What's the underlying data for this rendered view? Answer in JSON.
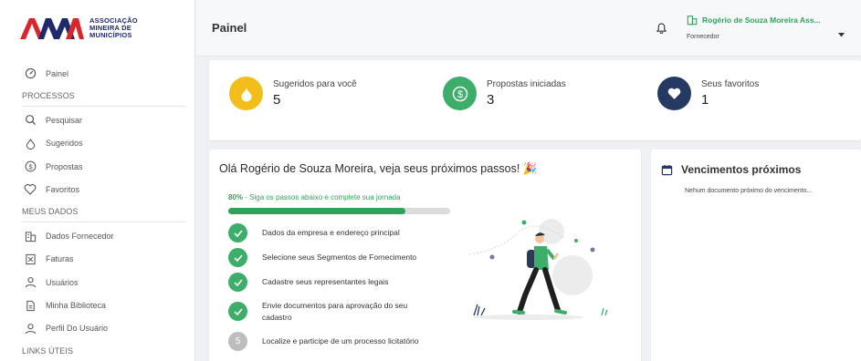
{
  "brand": {
    "name_line1": "ASSOCIAÇÃO",
    "name_line2": "MINEIRA DE",
    "name_line3": "MUNICÍPIOS",
    "colors": {
      "red": "#d9262c",
      "navy": "#1f2a6b"
    }
  },
  "sidebar": {
    "top_item": {
      "label": "Painel",
      "icon": "gauge-icon"
    },
    "sections": [
      {
        "title": "PROCESSOS",
        "items": [
          {
            "label": "Pesquisar",
            "icon": "search-icon"
          },
          {
            "label": "Sugeridos",
            "icon": "drop-icon"
          },
          {
            "label": "Propostas",
            "icon": "dollar-icon"
          },
          {
            "label": "Favoritos",
            "icon": "heart-icon"
          }
        ]
      },
      {
        "title": "MEUS DADOS",
        "items": [
          {
            "label": "Dados Fornecedor",
            "icon": "building-icon"
          },
          {
            "label": "Faturas",
            "icon": "invoice-icon"
          },
          {
            "label": "Usuários",
            "icon": "user-icon"
          },
          {
            "label": "Minha Biblioteca",
            "icon": "document-icon"
          },
          {
            "label": "Perfil Do Usuário",
            "icon": "user-profile-icon"
          }
        ]
      },
      {
        "title": "LINKS ÚTEIS",
        "items": []
      }
    ]
  },
  "header": {
    "title": "Painel",
    "user_name": "Rogério de Souza Moreira Ass...",
    "user_role": "Fornecedor",
    "accent": "#2fa35b"
  },
  "stats": [
    {
      "label": "Sugeridos para você",
      "value": "5",
      "icon": "drop-icon",
      "color": "#f2be1b"
    },
    {
      "label": "Propostas iniciadas",
      "value": "3",
      "icon": "dollar-icon",
      "color": "#3dad6a"
    },
    {
      "label": "Seus favoritos",
      "value": "1",
      "icon": "heart-icon",
      "color": "#253a63"
    }
  ],
  "main": {
    "title": "Olá Rogério de Souza Moreira, veja seus próximos passos! 🎉",
    "progress_percent": "80%",
    "progress_text": " - Siga os passos abaixo e complete sua jornada",
    "progress_fraction": 0.8,
    "steps": [
      {
        "text": "Dados da empresa e endereço principal",
        "done": true
      },
      {
        "text": "Selecione seus Segmentos de Fornecimento",
        "done": true
      },
      {
        "text": "Cadastre seus representantes legais",
        "done": true
      },
      {
        "text": "Envie documentos para aprovação do seu cadastro",
        "done": true
      },
      {
        "text": "Localize e participe de um processo licitatório",
        "done": false,
        "number": "5"
      }
    ]
  },
  "due": {
    "title": "Vencimentos próximos",
    "empty_text": "Nehum documento próximo do vencimento..."
  }
}
